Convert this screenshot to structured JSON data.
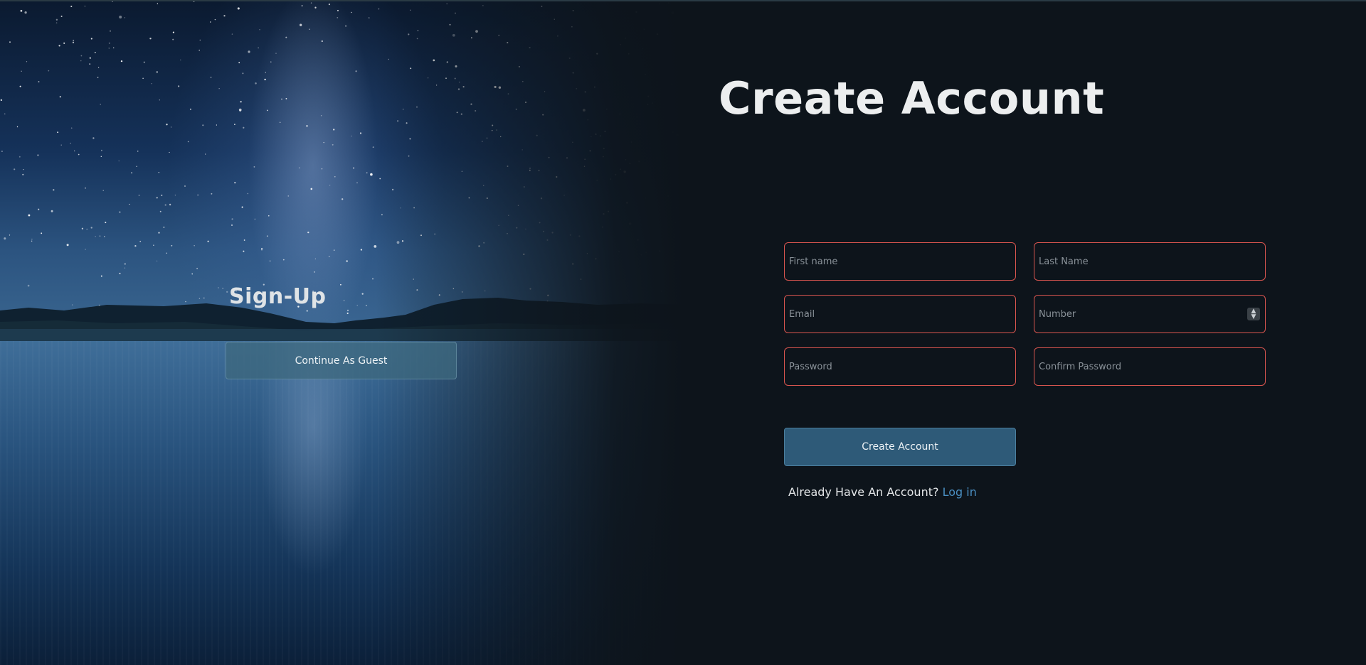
{
  "hero": {
    "title": "Sign-Up",
    "guest_button_label": "Continue As Guest"
  },
  "form": {
    "title": "Create Account",
    "fields": {
      "first_name": {
        "placeholder": "First name",
        "value": ""
      },
      "last_name": {
        "placeholder": "Last Name",
        "value": ""
      },
      "email": {
        "placeholder": "Email",
        "value": ""
      },
      "number": {
        "placeholder": "Number",
        "value": ""
      },
      "password": {
        "placeholder": "Password",
        "value": ""
      },
      "confirm_password": {
        "placeholder": "Confirm Password",
        "value": ""
      }
    },
    "submit_label": "Create Account",
    "login_prompt": "Already Have An Account?",
    "login_link_label": "Log in"
  },
  "icons": {
    "number_spinner": "up-down-spinner-icon"
  },
  "colors": {
    "background": "#0d141b",
    "field_border": "#d9554f",
    "button_fill": "#2e5a78",
    "link": "#4a8fc2"
  }
}
